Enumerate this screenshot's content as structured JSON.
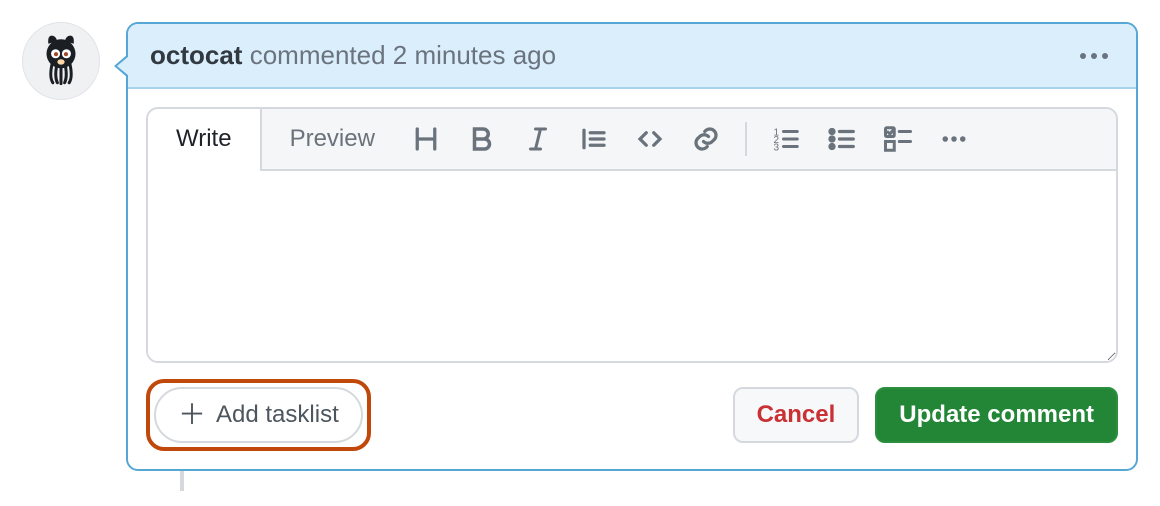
{
  "header": {
    "username": "octocat",
    "meta": "commented 2 minutes ago"
  },
  "tabs": {
    "write": "Write",
    "preview": "Preview"
  },
  "toolbar_icons": {
    "heading": "heading",
    "bold": "bold",
    "italic": "italic",
    "quote": "quote",
    "code": "code",
    "link": "link",
    "ordered": "ordered-list",
    "unordered": "unordered-list",
    "task": "task-list",
    "more": "more"
  },
  "textarea": {
    "value": "",
    "placeholder": ""
  },
  "footer": {
    "tasklist": "Add tasklist",
    "cancel": "Cancel",
    "submit": "Update comment"
  }
}
